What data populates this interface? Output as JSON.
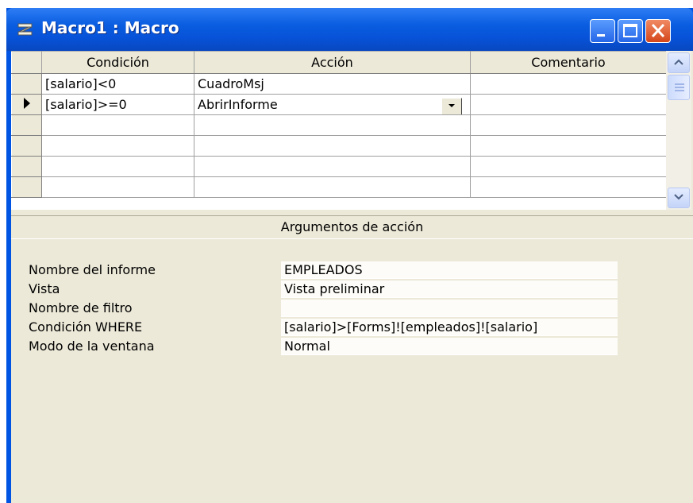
{
  "window": {
    "title": "Macro1 : Macro"
  },
  "grid": {
    "headers": [
      "Condición",
      "Acción",
      "Comentario"
    ],
    "rows": [
      {
        "condition": "[salario]<0",
        "action": "CuadroMsj",
        "comment": "",
        "selected": false
      },
      {
        "condition": "[salario]>=0",
        "action": "AbrirInforme",
        "comment": "",
        "selected": true
      },
      {
        "condition": "",
        "action": "",
        "comment": "",
        "selected": false
      },
      {
        "condition": "",
        "action": "",
        "comment": "",
        "selected": false
      },
      {
        "condition": "",
        "action": "",
        "comment": "",
        "selected": false
      },
      {
        "condition": "",
        "action": "",
        "comment": "",
        "selected": false
      }
    ]
  },
  "args": {
    "header": "Argumentos de acción",
    "fields": [
      {
        "label": "Nombre del informe",
        "value": "EMPLEADOS"
      },
      {
        "label": "Vista",
        "value": "Vista preliminar"
      },
      {
        "label": "Nombre de filtro",
        "value": ""
      },
      {
        "label": "Condición WHERE",
        "value": "[salario]>[Forms]![empleados]![salario]"
      },
      {
        "label": "Modo de la ventana",
        "value": "Normal"
      }
    ]
  },
  "colors": {
    "titlebar": "#0a5de0",
    "face": "#ece9d8",
    "close": "#d5461a"
  }
}
